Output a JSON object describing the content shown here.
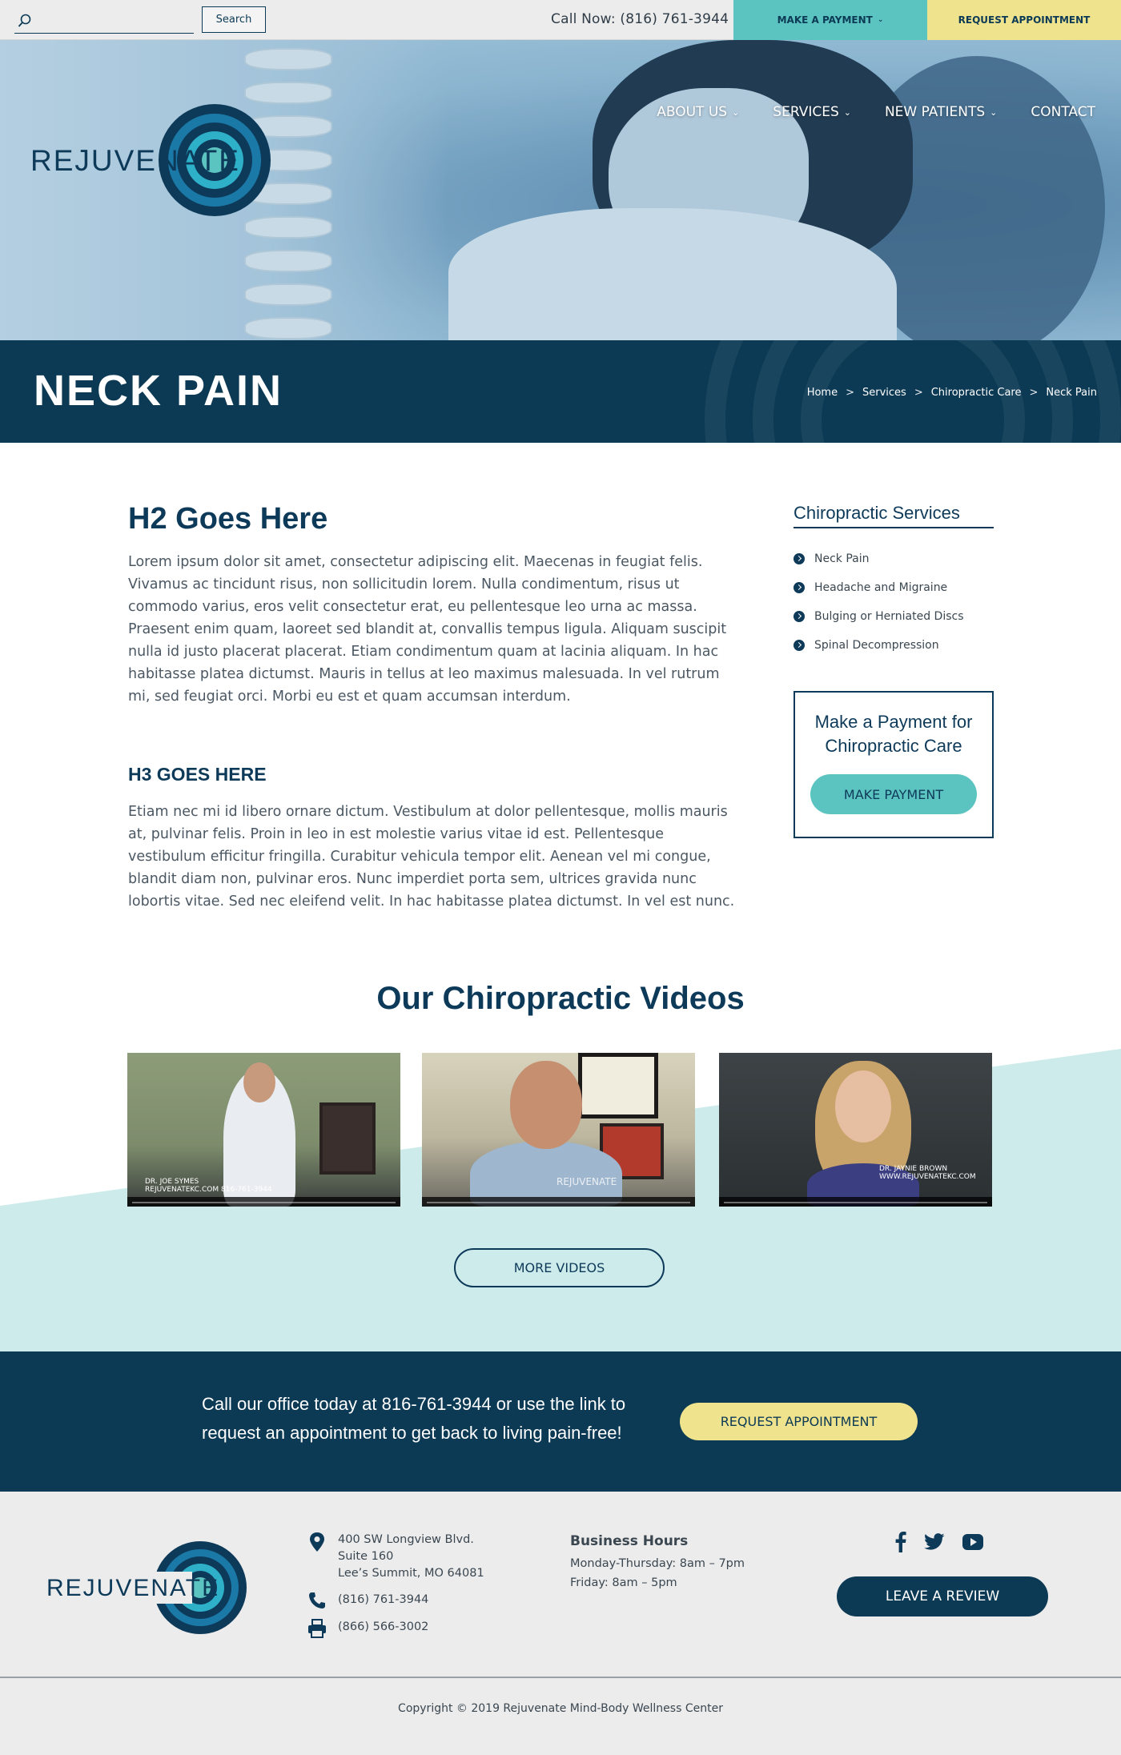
{
  "topbar": {
    "search_placeholder": "",
    "search_button": "Search",
    "call_now": "Call Now: (816) 761-3944",
    "make_payment": "MAKE A PAYMENT",
    "request_appointment": "REQUEST APPOINTMENT",
    "accent_teal": "#5cc4c0",
    "accent_yellow": "#efe38e"
  },
  "brand": {
    "logo_text": "REJUVENATE",
    "primary_color": "#0c3a55"
  },
  "nav": {
    "items": [
      {
        "label": "ABOUT US",
        "dropdown": true
      },
      {
        "label": "SERVICES",
        "dropdown": true
      },
      {
        "label": "NEW PATIENTS",
        "dropdown": true
      },
      {
        "label": "CONTACT",
        "dropdown": false
      }
    ]
  },
  "title_band": {
    "title": "NECK PAIN",
    "breadcrumb": [
      "Home",
      "Services",
      "Chiropractic Care",
      "Neck Pain"
    ],
    "separator": ">"
  },
  "main": {
    "h2": "H2 Goes Here",
    "p1": "Lorem ipsum dolor sit amet, consectetur adipiscing elit. Maecenas in feugiat felis. Vivamus ac tincidunt risus, non sollicitudin lorem. Nulla condimentum, risus ut commodo varius, eros velit consectetur erat, eu pellentesque leo urna ac massa. Praesent enim quam, laoreet sed blandit at, convallis tempus ligula. Aliquam suscipit nulla id justo placerat placerat. Etiam condimentum quam at lacinia aliquam. In hac habitasse platea dictumst. Mauris in tellus at leo maximus malesuada. In vel rutrum mi, sed feugiat orci. Morbi eu est et quam accumsan interdum.",
    "h3": "H3 GOES HERE",
    "p2": "Etiam nec mi id libero ornare dictum. Vestibulum at dolor pellentesque, mollis mauris at, pulvinar felis. Proin in leo in est molestie varius vitae id est. Pellentesque vestibulum efficitur fringilla. Curabitur vehicula tempor elit. Aenean vel mi congue, blandit diam non, pulvinar eros. Nunc imperdiet porta sem, ultrices gravida nunc lobortis vitae. Sed nec eleifend velit. In hac habitasse platea dictumst. In vel est nunc."
  },
  "sidebar": {
    "title": "Chiropractic Services",
    "items": [
      "Neck Pain",
      "Headache and Migraine",
      "Bulging or Herniated Discs",
      "Spinal Decompression"
    ],
    "payment_box": {
      "title": "Make a Payment for Chiropractic Care",
      "button": "MAKE PAYMENT"
    }
  },
  "videos": {
    "title": "Our Chiropractic Videos",
    "items": [
      {
        "caption_line1": "DR. JOE SYMES",
        "caption_line2": "REJUVENATEKC.COM 816-761-3944"
      },
      {
        "caption_line1": "REJUVENATE",
        "caption_line2": ""
      },
      {
        "caption_line1": "DR. JAYNIE BROWN",
        "caption_line2": "WWW.REJUVENATEKC.COM"
      }
    ],
    "more_button": "MORE VIDEOS"
  },
  "cta": {
    "text": "Call our office today at 816-761-3944 or use the link to request an appointment to get back to living pain-free!",
    "button": "REQUEST APPOINTMENT"
  },
  "footer": {
    "address_line1": "400 SW Longview Blvd.",
    "address_line2": "Suite 160",
    "address_line3": "Lee’s Summit, MO 64081",
    "phone": "(816) 761-3944",
    "fax": "(866) 566-3002",
    "hours_title": "Business Hours",
    "hours_weekday": "Monday-Thursday: 8am – 7pm",
    "hours_friday": "Friday: 8am – 5pm",
    "social": [
      "facebook-icon",
      "twitter-icon",
      "youtube-icon"
    ],
    "review_button": "LEAVE A REVIEW",
    "copyright": "Copyright © 2019 Rejuvenate Mind-Body Wellness Center"
  }
}
